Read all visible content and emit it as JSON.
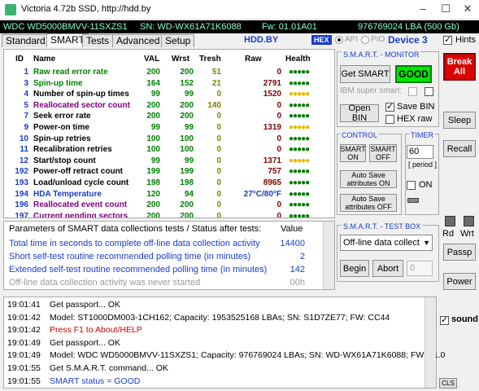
{
  "window": {
    "title": "Victoria 4.72b SSD, http://hdd.by"
  },
  "infobar": {
    "model": "WDC WD5000BMVV-11SXZS1",
    "serial": "SN: WD-WX61A71K6088",
    "firmware": "Fw: 01.01A01",
    "capacity": "976769024 LBA (500 Gb)"
  },
  "tabs": [
    "Standard",
    "SMART",
    "Tests",
    "Advanced",
    "Setup"
  ],
  "active_tab": "SMART",
  "header": {
    "hddby": "HDD.BY",
    "hex": "HEX",
    "api": "API",
    "pio": "PIO",
    "device": "Device 3",
    "hints": "Hints"
  },
  "smart_table": {
    "columns": [
      "ID",
      "Name",
      "VAL",
      "Wrst",
      "Tresh",
      "Raw",
      "Health"
    ],
    "rows": [
      {
        "id": "1",
        "name": "Raw read error rate",
        "val": "200",
        "wrst": "200",
        "tresh": "51",
        "raw": "0",
        "health": "●●●●●",
        "name_color": "#008000",
        "health_color": "#008000"
      },
      {
        "id": "3",
        "name": "Spin-up time",
        "val": "164",
        "wrst": "152",
        "tresh": "21",
        "raw": "2791",
        "health": "●●●●●",
        "name_color": "#008000",
        "health_color": "#008000"
      },
      {
        "id": "4",
        "name": "Number of spin-up times",
        "val": "99",
        "wrst": "99",
        "tresh": "0",
        "raw": "1520",
        "health": "●●●●●",
        "name_color": "#000000",
        "health_color": "#e6b800"
      },
      {
        "id": "5",
        "name": "Reallocated sector count",
        "val": "200",
        "wrst": "200",
        "tresh": "140",
        "raw": "0",
        "health": "●●●●●",
        "name_color": "#800080",
        "health_color": "#008000"
      },
      {
        "id": "7",
        "name": "Seek error rate",
        "val": "200",
        "wrst": "200",
        "tresh": "0",
        "raw": "0",
        "health": "●●●●●",
        "name_color": "#000000",
        "health_color": "#008000"
      },
      {
        "id": "9",
        "name": "Power-on time",
        "val": "99",
        "wrst": "99",
        "tresh": "0",
        "raw": "1319",
        "health": "●●●●●",
        "name_color": "#000000",
        "health_color": "#e6b800"
      },
      {
        "id": "10",
        "name": "Spin-up retries",
        "val": "100",
        "wrst": "100",
        "tresh": "0",
        "raw": "0",
        "health": "●●●●●",
        "name_color": "#000000",
        "health_color": "#008000"
      },
      {
        "id": "11",
        "name": "Recalibration retries",
        "val": "100",
        "wrst": "100",
        "tresh": "0",
        "raw": "0",
        "health": "●●●●●",
        "name_color": "#000000",
        "health_color": "#008000"
      },
      {
        "id": "12",
        "name": "Start/stop count",
        "val": "99",
        "wrst": "99",
        "tresh": "0",
        "raw": "1371",
        "health": "●●●●●",
        "name_color": "#000000",
        "health_color": "#e6b800"
      },
      {
        "id": "192",
        "name": "Power-off retract count",
        "val": "199",
        "wrst": "199",
        "tresh": "0",
        "raw": "757",
        "health": "●●●●●",
        "name_color": "#000000",
        "health_color": "#008000"
      },
      {
        "id": "193",
        "name": "Load/unload cycle count",
        "val": "198",
        "wrst": "198",
        "tresh": "0",
        "raw": "8965",
        "health": "●●●●●",
        "name_color": "#000000",
        "health_color": "#008000"
      },
      {
        "id": "194",
        "name": "HDA Temperature",
        "val": "120",
        "wrst": "94",
        "tresh": "0",
        "raw": "27°C/80°F",
        "health": "●●●●●",
        "name_color": "#1a3ccc",
        "health_color": "#008000",
        "raw_color": "#1a3ccc"
      },
      {
        "id": "196",
        "name": "Reallocated event count",
        "val": "200",
        "wrst": "200",
        "tresh": "0",
        "raw": "0",
        "health": "●●●●●",
        "name_color": "#800080",
        "health_color": "#008000"
      },
      {
        "id": "197",
        "name": "Current pending sectors",
        "val": "200",
        "wrst": "200",
        "tresh": "0",
        "raw": "0",
        "health": "●●●●●",
        "name_color": "#800080",
        "health_color": "#008000"
      }
    ]
  },
  "params": {
    "header_label": "Parameters of SMART data collections tests / Status after tests:",
    "header_value": "Value",
    "rows": [
      {
        "label": "Total time in seconds to complete off-line data collection activity",
        "value": "14400",
        "dim": false
      },
      {
        "label": "Short self-test routine recommended polling time (in minutes)",
        "value": "2",
        "dim": false
      },
      {
        "label": "Extended self-test routine recommended polling time (in minutes)",
        "value": "142",
        "dim": false
      },
      {
        "label": "Off-line data collection activity was never started",
        "value": "00h",
        "dim": true
      }
    ]
  },
  "log": [
    {
      "time": "19:01:41",
      "msg": "Get passport... OK",
      "color": "#000000"
    },
    {
      "time": "19:01:42",
      "msg": "Model: ST1000DM003-1CH162; Capacity: 1953525168 LBAs; SN: S1D7ZE77; FW: CC44",
      "color": "#000000"
    },
    {
      "time": "19:01:42",
      "msg": "Press F1 to About/HELP",
      "color": "#cc0000"
    },
    {
      "time": "19:01:49",
      "msg": "Get passport... OK",
      "color": "#000000"
    },
    {
      "time": "19:01:49",
      "msg": "Model: WDC WD5000BMVV-11SXZS1; Capacity: 976769024 LBAs; SN: WD-WX61A71K6088; FW: 01.0",
      "color": "#000000"
    },
    {
      "time": "19:01:55",
      "msg": "Get S.M.A.R.T. command... OK",
      "color": "#000000"
    },
    {
      "time": "19:01:55",
      "msg": "SMART status = GOOD",
      "color": "#1a3ccc"
    }
  ],
  "smart_monitor": {
    "title": "S.M.A.R.T. - MONITOR",
    "get_smart": "Get SMART",
    "status": "GOOD",
    "ibm_super_smart": "IBM super smart:",
    "open_bin": "Open BIN",
    "save_bin": "Save BIN",
    "hex_raw": "HEX raw"
  },
  "control": {
    "title": "CONTROL",
    "smart_on": "SMART ON",
    "smart_off": "SMART OFF",
    "autosave_on": "Auto Save attributes ON",
    "autosave_off": "Auto Save attributes OFF"
  },
  "timer": {
    "title": "TIMER",
    "value": "60",
    "period": "[ period ]",
    "on_label": "ON"
  },
  "test_box": {
    "title": "S.M.A.R.T. - TEST BOX",
    "selected_test": "Off-line data collect",
    "begin": "Begin",
    "abort": "Abort",
    "counter": "0"
  },
  "side": {
    "break_line1": "Break",
    "break_line2": "All",
    "sleep": "Sleep",
    "recall": "Recall",
    "rd": "Rd",
    "wrt": "Wrt",
    "passp": "Passp",
    "power": "Power",
    "sound": "sound",
    "cls": "CLS"
  }
}
